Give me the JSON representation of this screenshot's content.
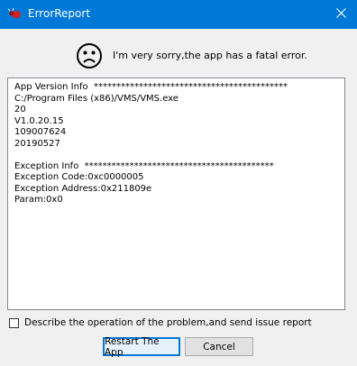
{
  "window": {
    "title": "ErrorReport"
  },
  "message": {
    "text": "I'm very sorry,the app has a fatal error."
  },
  "report": {
    "lines": [
      "App Version Info  *******************************************",
      "C:/Program Files (x86)/VMS/VMS.exe",
      "20",
      "V1.0.20.15",
      "109007624",
      "20190527",
      "",
      "Exception Info  ******************************************",
      "Exception Code:0xc0000005",
      "Exception Address:0x211809e",
      "Param:0x0"
    ]
  },
  "send_report": {
    "label": "Describe the operation of the problem,and send issue report",
    "checked": false
  },
  "buttons": {
    "restart": "Restart The App",
    "cancel": "Cancel"
  },
  "icons": {
    "app": "bug-icon",
    "close": "close-icon",
    "face": "sad-face-icon"
  },
  "colors": {
    "titlebar": "#0078d7",
    "background": "#f0f0f0"
  }
}
